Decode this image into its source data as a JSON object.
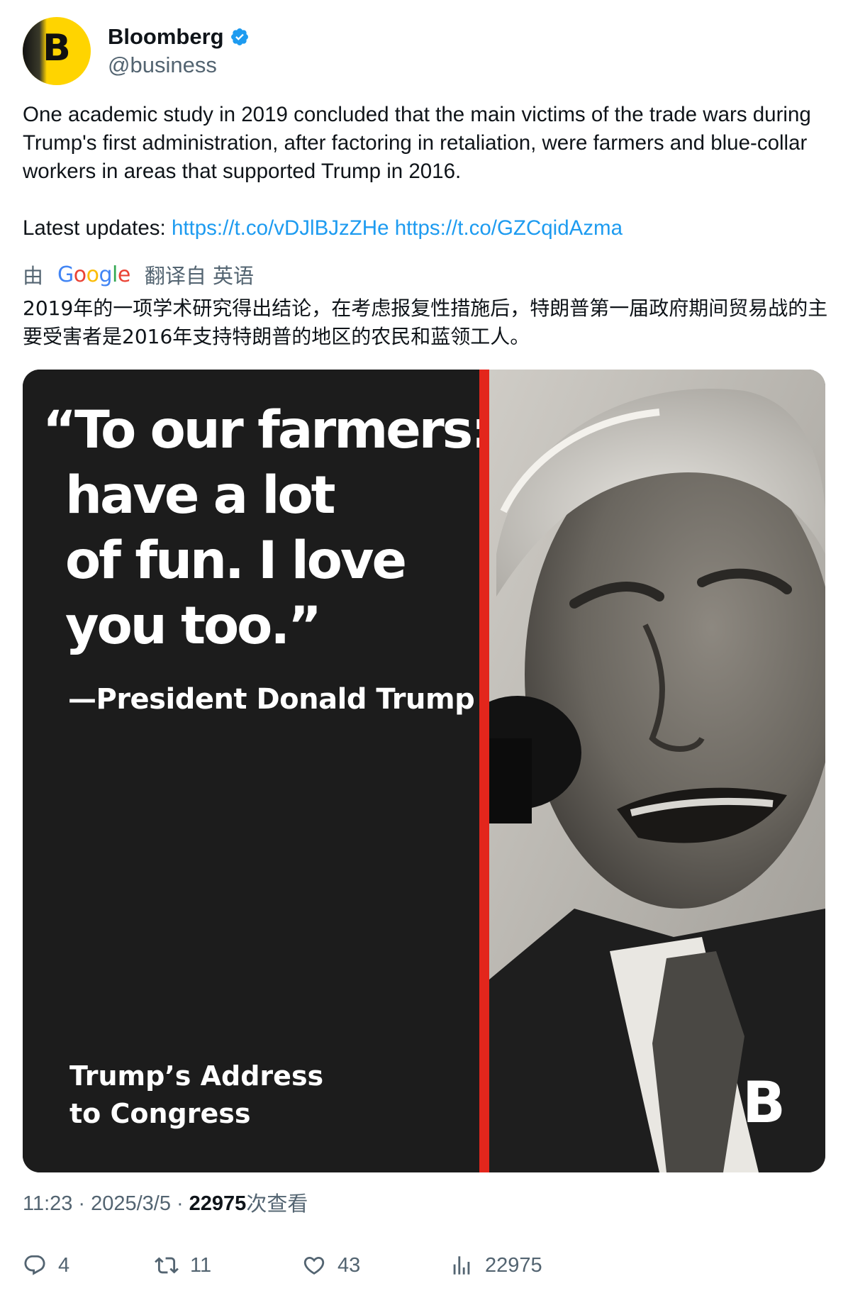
{
  "account": {
    "display_name": "Bloomberg",
    "handle": "@business",
    "avatar_letter": "B",
    "verified": true,
    "avatar_color": "#ffd400",
    "verified_color": "#1d9bf0"
  },
  "tweet": {
    "text": "One academic study in 2019 concluded that the main victims of the trade wars during Trump's first administration, after factoring in retaliation, were farmers and blue-collar workers in areas that supported Trump in 2016.",
    "latest_label": "Latest updates: ",
    "links": [
      "https://t.co/vDJlBJzZHe",
      "https://t.co/GZCqidAzma"
    ],
    "link_color": "#1d9bf0"
  },
  "translation": {
    "prefix": "由",
    "provider": "Google",
    "suffix": "翻译自 英语",
    "text": "2019年的一项学术研究得出结论，在考虑报复性措施后，特朗普第一届政府期间贸易战的主要受害者是2016年支持特朗普的地区的农民和蓝领工人。"
  },
  "media": {
    "quote_lines": [
      "“To our farmers:",
      "have a lot",
      "of fun. I love",
      "you too.”"
    ],
    "attribution": "—President Donald Trump",
    "event_lines": [
      "Trump’s Address",
      "to Congress"
    ],
    "brand_mark": "B",
    "panel_color": "#1c1c1c",
    "accent_color": "#e3261c"
  },
  "meta": {
    "time": "11:23",
    "date": "2025/3/5",
    "views": "22975",
    "views_label": "次查看"
  },
  "actions": {
    "replies": "4",
    "retweets": "11",
    "likes": "43",
    "views": "22975",
    "icons": [
      "reply-icon",
      "retweet-icon",
      "like-icon",
      "views-icon"
    ]
  }
}
